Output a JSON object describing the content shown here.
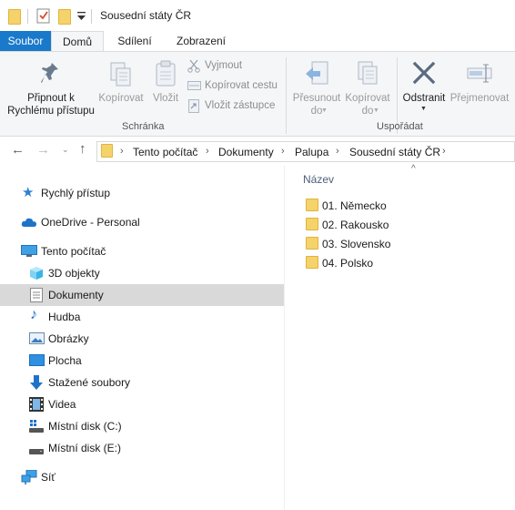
{
  "window": {
    "title": "Sousední státy ČR"
  },
  "tabs": [
    "Soubor",
    "Domů",
    "Sdílení",
    "Zobrazení"
  ],
  "ribbon": {
    "pin": "Připnout k\nRychlému přístupu",
    "copy": "Kopírovat",
    "paste": "Vložit",
    "cut": "Vyjmout",
    "copy_path": "Kopírovat cestu",
    "paste_shortcut": "Vložit zástupce",
    "clipboard_group": "Schránka",
    "move_to": "Přesunout\ndo",
    "copy_to": "Kopírovat\ndo",
    "delete": "Odstranit",
    "rename": "Přejmenovat",
    "organize_group": "Uspořádat"
  },
  "address": {
    "crumbs": [
      "Tento počítač",
      "Dokumenty",
      "Palupa",
      "Sousední státy ČR"
    ]
  },
  "nav": {
    "quick_access": "Rychlý přístup",
    "onedrive": "OneDrive - Personal",
    "this_pc": "Tento počítač",
    "items": [
      "3D objekty",
      "Dokumenty",
      "Hudba",
      "Obrázky",
      "Plocha",
      "Stažené soubory",
      "Videa",
      "Místní disk (C:)",
      "Místní disk (E:)"
    ],
    "network": "Síť",
    "selected": "Dokumenty"
  },
  "content": {
    "column_name": "Název",
    "folders": [
      "01. Německo",
      "02. Rakousko",
      "03. Slovensko",
      "04. Polsko"
    ]
  },
  "colors": {
    "accent": "#1979ca",
    "folder": "#f5d36b",
    "selected_bg": "#d9d9d9"
  }
}
